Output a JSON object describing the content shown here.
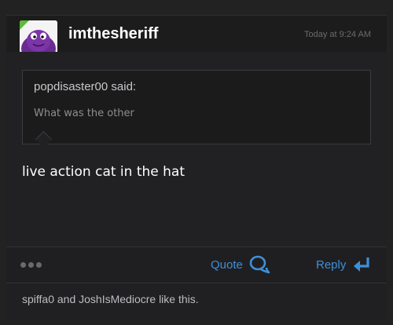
{
  "post": {
    "username": "imthesheriff",
    "timestamp": "Today at 9:24 AM",
    "quote": {
      "author": "popdisaster00 said:",
      "text": "What was the other"
    },
    "message": "live action cat in the hat",
    "actions": {
      "quote_label": "Quote",
      "reply_label": "Reply"
    },
    "likes_text": "spiffa0 and JoshIsMediocre like this."
  },
  "colors": {
    "link": "#3f8fd8",
    "online": "#5dbb3a"
  },
  "icons": [
    "more-icon",
    "quote-bubbles-icon",
    "reply-arrow-icon"
  ]
}
